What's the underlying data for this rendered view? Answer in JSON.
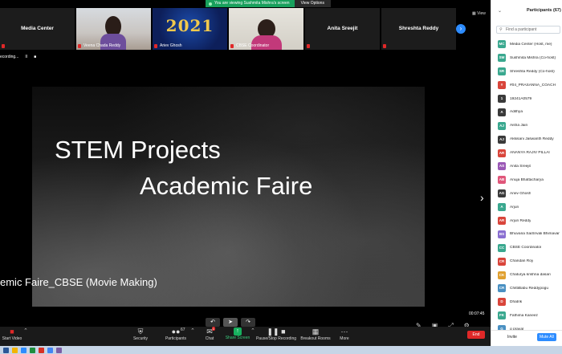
{
  "banner": {
    "text": "You are viewing Sushmita Mishra's screen",
    "view_options": "View Options"
  },
  "strip": {
    "tiles": [
      {
        "name": "Media Center"
      },
      {
        "name": "Veena Chada Reddy"
      },
      {
        "name": "Ariev Ghosh"
      },
      {
        "name": "CBSE Coordinator"
      },
      {
        "name": "Anita Sreejit"
      },
      {
        "name": "Shreshta Reddy"
      }
    ],
    "year_text": "2021",
    "view": "View"
  },
  "recording": {
    "label": "ecording...",
    "pause": "II",
    "stop": "■"
  },
  "slide": {
    "line1": "STEM Projects",
    "line2": "Academic Faire",
    "caption": "emic Faire_CBSE (Movie Making)"
  },
  "timer": "00:07:45",
  "toolbar": {
    "start_video": "Start Video",
    "security": "Security",
    "participants": "Participants",
    "participants_count": "67",
    "chat": "Chat",
    "chat_badge": "1",
    "share_screen": "Share Screen",
    "pause_recording": "Pause/Stop Recording",
    "breakout": "Breakout Rooms",
    "more": "More",
    "end": "End"
  },
  "panel": {
    "title": "Participants (67)",
    "search_placeholder": "Find a participant",
    "participants": [
      {
        "initials": "MC",
        "name": "Media Center (Host, me)",
        "color": "#3aa88f"
      },
      {
        "initials": "SM",
        "name": "Sushmita Mishra (Co-host)",
        "color": "#3aa88f"
      },
      {
        "initials": "SR",
        "name": "Shreshta Reddy (Co-host)",
        "color": "#3aa88f"
      },
      {
        "initials": "#",
        "name": "#04_PRASANNA_COACH",
        "color": "#d9453b"
      },
      {
        "initials": "1",
        "name": "19241A0579",
        "color": "#3a3a3a"
      },
      {
        "initials": "A",
        "name": "Adithya",
        "color": "#3a3a3a"
      },
      {
        "initials": "AJ",
        "name": "Aisha Jain",
        "color": "#3aa88f"
      },
      {
        "initials": "AJ",
        "name": "Akkisani Jaswanth Reddy",
        "color": "#3a3a3a"
      },
      {
        "initials": "AR",
        "name": "ANANYA RAJIV PILLAI",
        "color": "#d9453b"
      },
      {
        "initials": "AS",
        "name": "Anita Sreejit",
        "color": "#9b59b6"
      },
      {
        "initials": "AB",
        "name": "Anuja Bhattacharya",
        "color": "#e0567a"
      },
      {
        "initials": "AG",
        "name": "Ariev Ghosh",
        "color": "#3a3a3a"
      },
      {
        "initials": "A",
        "name": "Arjun",
        "color": "#3aa88f"
      },
      {
        "initials": "AR",
        "name": "Arjun Reddy",
        "color": "#d9453b"
      },
      {
        "initials": "BS",
        "name": "Bhuvana SaiSrivali Bhimavar",
        "color": "#8a6fd1"
      },
      {
        "initials": "CC",
        "name": "CBSE Coordinator",
        "color": "#3aa88f"
      },
      {
        "initials": "CR",
        "name": "Chandan Roy",
        "color": "#d9453b"
      },
      {
        "initials": "CK",
        "name": "Chaturya krishna dasari",
        "color": "#e0a030"
      },
      {
        "initials": "CR",
        "name": "ChittiBabu Reddypogu",
        "color": "#4a90c2"
      },
      {
        "initials": "D",
        "name": "Dhatrik",
        "color": "#d9453b"
      },
      {
        "initials": "FK",
        "name": "Fathima Kaneez",
        "color": "#3aa88f"
      },
      {
        "initials": "G",
        "name": "g praval",
        "color": "#4a90c2"
      }
    ],
    "invite": "Invite",
    "mute_all": "Mute All"
  }
}
